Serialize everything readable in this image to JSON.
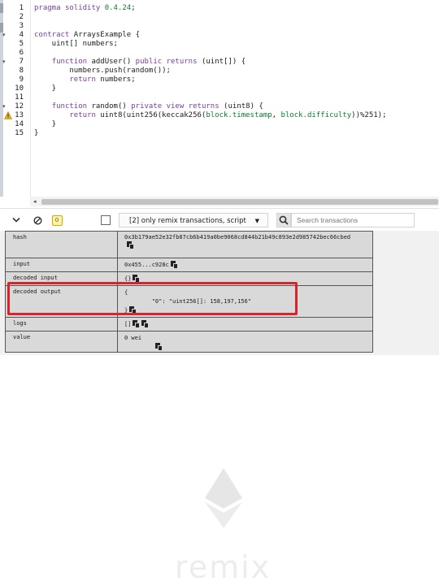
{
  "editor": {
    "lines": [
      {
        "n": "1",
        "text": "pragma solidity 0.4.24;"
      },
      {
        "n": "2",
        "text": ""
      },
      {
        "n": "3",
        "text": ""
      },
      {
        "n": "4",
        "text": "contract ArraysExample {"
      },
      {
        "n": "5",
        "text": "    uint[] numbers;"
      },
      {
        "n": "6",
        "text": ""
      },
      {
        "n": "7",
        "text": "    function addUser() public returns (uint[]) {"
      },
      {
        "n": "8",
        "text": "        numbers.push(random());"
      },
      {
        "n": "9",
        "text": "        return numbers;"
      },
      {
        "n": "10",
        "text": "    }"
      },
      {
        "n": "11",
        "text": ""
      },
      {
        "n": "12",
        "text": "    function random() private view returns (uint8) {"
      },
      {
        "n": "13",
        "text": "        return uint8(uint256(keccak256(block.timestamp, block.difficulty))%251);"
      },
      {
        "n": "14",
        "text": "    }"
      },
      {
        "n": "15",
        "text": "}"
      }
    ],
    "warning_line": "13"
  },
  "toolbar": {
    "pending_count": "0",
    "filter_label": "[2] only remix transactions, script",
    "search_placeholder": "Search transactions"
  },
  "tx_details": {
    "hash": {
      "key": "hash",
      "value": "0x3b179ae52e32fb87cb6b419a0be9068cd844b21b49c893e2d985742bec66cbed"
    },
    "input": {
      "key": "input",
      "value": "0x455...c928c"
    },
    "decoded_input": {
      "key": "decoded input",
      "value": "{}"
    },
    "decoded_output": {
      "key": "decoded output",
      "line1": "{",
      "line2": "        \"0\": \"uint256[]: 158,197,156\"",
      "line3": "}"
    },
    "logs": {
      "key": "logs",
      "value": "[]"
    },
    "value": {
      "key": "value",
      "value": "0 wei"
    }
  },
  "watermark": "remix",
  "colors": {
    "highlight": "#d8242b",
    "keyword": "#7a3e9d",
    "version": "#0a7d33"
  }
}
